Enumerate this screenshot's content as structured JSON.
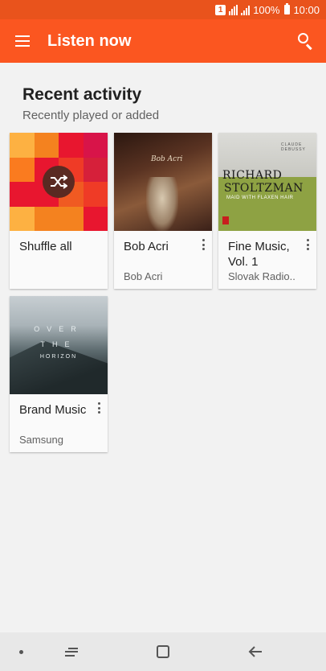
{
  "status_bar": {
    "sim_badge": "1",
    "battery_percent": "100%",
    "time": "10:00"
  },
  "app_bar": {
    "menu_icon": "hamburger-menu-icon",
    "title": "Listen now",
    "search_icon": "search-icon"
  },
  "section": {
    "title": "Recent activity",
    "subtitle": "Recently played or added"
  },
  "cards": [
    {
      "title": "Shuffle all",
      "subtitle": "",
      "art": "shuffle-tile-art",
      "has_more_menu": false
    },
    {
      "title": "Bob Acri",
      "subtitle": "Bob Acri",
      "art": "album-cover-bob-acri",
      "has_more_menu": true
    },
    {
      "title": "Fine Music, Vol. 1",
      "subtitle": "Slovak Radio..",
      "art": "album-cover-fine-music",
      "has_more_menu": true
    },
    {
      "title": "Brand Music",
      "subtitle": "Samsung",
      "art": "album-cover-brand-music",
      "has_more_menu": true
    }
  ],
  "album_art_text": {
    "bob_acri": "Bob Acri",
    "fine_top": "CLAUDE DEBUSSY",
    "fine_line1": "RICHARD",
    "fine_line2": "STOLTZMAN",
    "fine_line3": "MAID WITH FLAXEN HAIR",
    "brand_line1": "OVER",
    "brand_line2": "THE",
    "brand_line3": "HORIZON"
  },
  "colors": {
    "status_bar": "#e9531c",
    "app_bar": "#fb5620",
    "background": "#f2f2f2",
    "shuffle_tiles": [
      "#fdb142",
      "#f4821f",
      "#e8162f",
      "#d81449",
      "#fa7b1f",
      "#e8162f",
      "#ef3b26",
      "#d6203a",
      "#e8162f",
      "#e8162f",
      "#f05a22",
      "#ef3b26",
      "#fdb142",
      "#f4821f",
      "#f4821f",
      "#e8162f"
    ]
  },
  "nav_bar": {
    "recent_apps_icon": "recent-apps-icon",
    "home_icon": "home-icon",
    "back_icon": "back-arrow-icon"
  }
}
